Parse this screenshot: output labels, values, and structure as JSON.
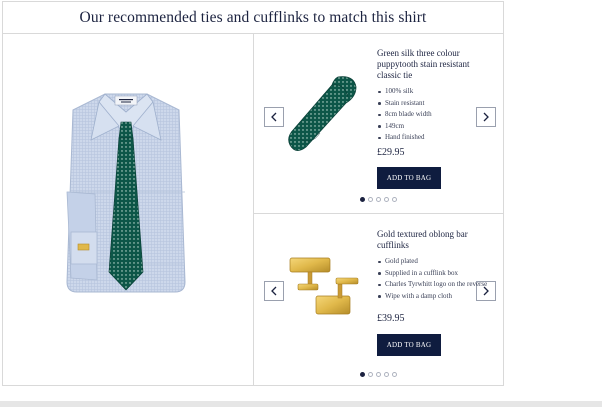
{
  "header": {
    "title": "Our recommended ties and cufflinks to match this shirt"
  },
  "colors": {
    "navy": "#0f1c3f",
    "tie_green": "#0d5648",
    "gold": "#e0b84a",
    "shirt_blue": "#c9d6ea"
  },
  "products": [
    {
      "title": "Green silk three colour puppytooth stain resistant classic tie",
      "features": [
        "100% silk",
        "Stain resistant",
        "8cm blade width",
        "149cm",
        "Hand finished"
      ],
      "price": "£29.95",
      "button_label": "ADD TO BAG",
      "prev_icon": "chevron-left-icon",
      "next_icon": "chevron-right-icon",
      "carousel": {
        "count": 5,
        "active": 1
      }
    },
    {
      "title": "Gold textured oblong bar cufflinks",
      "features": [
        "Gold plated",
        "Supplied in a cufflink box",
        "Charles Tyrwhitt logo on the reverse",
        "Wipe with a damp cloth"
      ],
      "price": "£39.95",
      "button_label": "ADD TO BAG",
      "prev_icon": "chevron-left-icon",
      "next_icon": "chevron-right-icon",
      "carousel": {
        "count": 5,
        "active": 1
      }
    }
  ]
}
